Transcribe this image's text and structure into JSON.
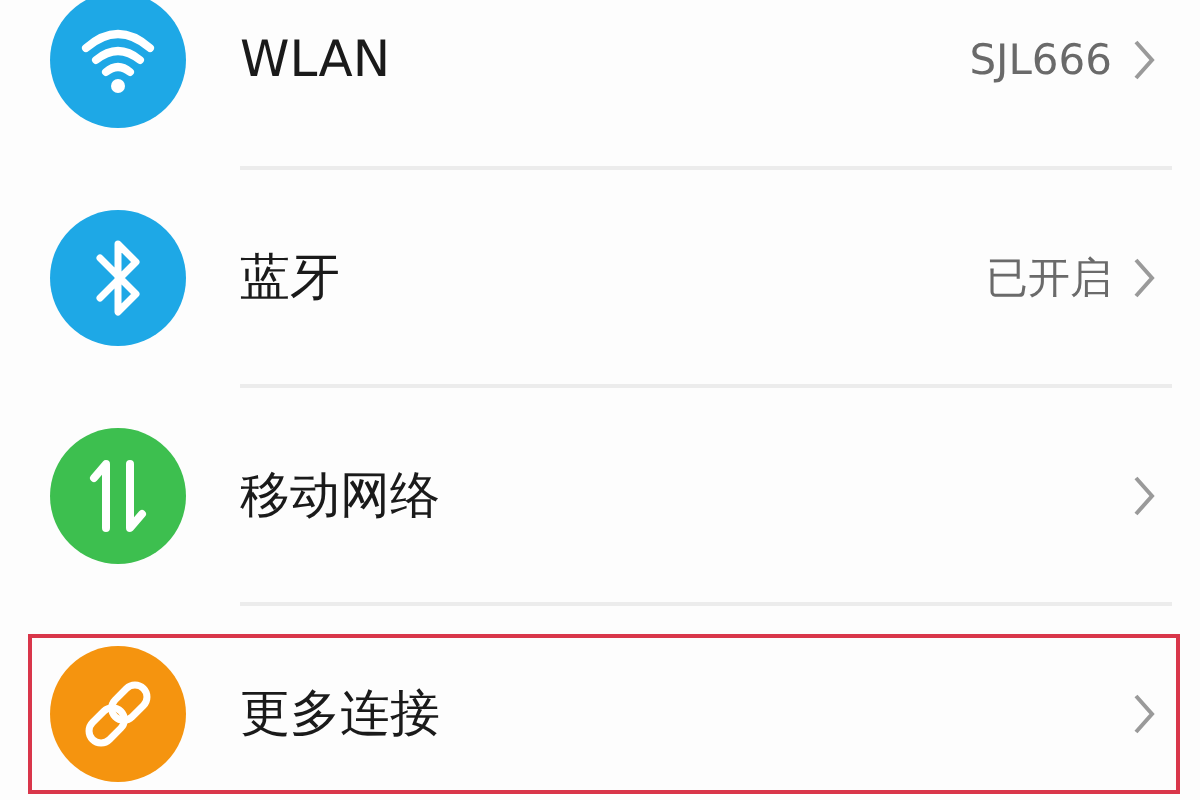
{
  "settings_list": [
    {
      "kind": "wifi",
      "color": "#1ea8e6",
      "label": "WLAN",
      "value": "SJL666",
      "highlighted": false
    },
    {
      "kind": "bluetooth",
      "color": "#1ea8e6",
      "label": "蓝牙",
      "value": "已开启",
      "highlighted": false
    },
    {
      "kind": "mobile_data",
      "color": "#3dbf4f",
      "label": "移动网络",
      "highlighted": false
    },
    {
      "kind": "link",
      "color": "#f5940f",
      "label": "更多连接",
      "highlighted": true
    }
  ]
}
